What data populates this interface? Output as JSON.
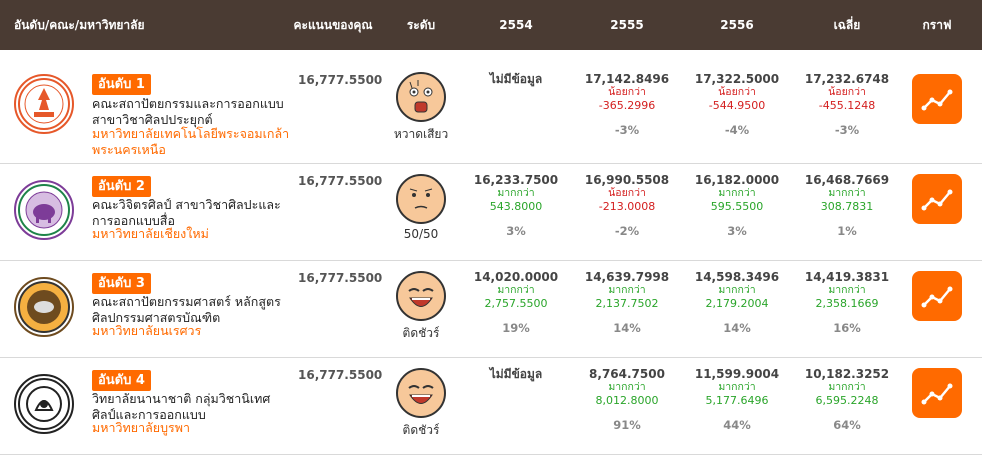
{
  "header": {
    "university": "อันดับ/คณะ/มหาวิทยาลัย",
    "score": "คะแนนของคุณ",
    "level": "ระดับ",
    "y2554": "2554",
    "y2555": "2555",
    "y2556": "2556",
    "avg": "เฉลี่ย",
    "graph": "กราฟ"
  },
  "rows": [
    {
      "rank": "อันดับ 1",
      "faculty": "คณะสถาปัตยกรรมและการออกแบบ สาขาวิชาศิลปประยุกต์",
      "university": "มหาวิทยาลัยเทคโนโลยีพระจอมเกล้าพระนครเหนือ",
      "score": "16,777.5500",
      "level": "หวาดเสียว",
      "face_icon": "scared-face-icon",
      "y2554": {
        "value": "ไม่มีข้อมูล"
      },
      "y2555": {
        "value": "17,142.8496",
        "cmp": "น้อยกว่า",
        "diff": "-365.2996",
        "pct": "-3%",
        "trend": "down"
      },
      "y2556": {
        "value": "17,322.5000",
        "cmp": "น้อยกว่า",
        "diff": "-544.9500",
        "pct": "-4%",
        "trend": "down"
      },
      "avg": {
        "value": "17,232.6748",
        "cmp": "น้อยกว่า",
        "diff": "-455.1248",
        "pct": "-3%",
        "trend": "down"
      }
    },
    {
      "rank": "อันดับ 2",
      "faculty": "คณะวิจิตรศิลป์ สาขาวิชาศิลปะและการออกแบบสื่อ",
      "university": "มหาวิทยาลัยเชียงใหม่",
      "score": "16,777.5500",
      "level": "50/50",
      "face_icon": "worried-face-icon",
      "y2554": {
        "value": "16,233.7500",
        "cmp": "มากกว่า",
        "diff": "543.8000",
        "pct": "3%",
        "trend": "up"
      },
      "y2555": {
        "value": "16,990.5508",
        "cmp": "น้อยกว่า",
        "diff": "-213.0008",
        "pct": "-2%",
        "trend": "down"
      },
      "y2556": {
        "value": "16,182.0000",
        "cmp": "มากกว่า",
        "diff": "595.5500",
        "pct": "3%",
        "trend": "up"
      },
      "avg": {
        "value": "16,468.7669",
        "cmp": "มากกว่า",
        "diff": "308.7831",
        "pct": "1%",
        "trend": "up"
      }
    },
    {
      "rank": "อันดับ 3",
      "faculty": "คณะสถาปัตยกรรมศาสตร์ หลักสูตรศิลปกรรมศาสตรบัณฑิต",
      "university": "มหาวิทยาลัยนเรศวร",
      "score": "16,777.5500",
      "level": "ติดชัวร์",
      "face_icon": "happy-face-icon",
      "y2554": {
        "value": "14,020.0000",
        "cmp": "มากกว่า",
        "diff": "2,757.5500",
        "pct": "19%",
        "trend": "up"
      },
      "y2555": {
        "value": "14,639.7998",
        "cmp": "มากกว่า",
        "diff": "2,137.7502",
        "pct": "14%",
        "trend": "up"
      },
      "y2556": {
        "value": "14,598.3496",
        "cmp": "มากกว่า",
        "diff": "2,179.2004",
        "pct": "14%",
        "trend": "up"
      },
      "avg": {
        "value": "14,419.3831",
        "cmp": "มากกว่า",
        "diff": "2,358.1669",
        "pct": "16%",
        "trend": "up"
      }
    },
    {
      "rank": "อันดับ 4",
      "faculty": "วิทยาลัยนานาชาติ กลุ่มวิชานิเทศศิลป์และการออกแบบ",
      "university": "มหาวิทยาลัยบูรพา",
      "score": "16,777.5500",
      "level": "ติดชัวร์",
      "face_icon": "happy-face-icon",
      "y2554": {
        "value": "ไม่มีข้อมูล"
      },
      "y2555": {
        "value": "8,764.7500",
        "cmp": "มากกว่า",
        "diff": "8,012.8000",
        "pct": "91%",
        "trend": "up"
      },
      "y2556": {
        "value": "11,599.9004",
        "cmp": "มากกว่า",
        "diff": "5,177.6496",
        "pct": "44%",
        "trend": "up"
      },
      "avg": {
        "value": "10,182.3252",
        "cmp": "มากกว่า",
        "diff": "6,595.2248",
        "pct": "64%",
        "trend": "up"
      }
    }
  ],
  "colors": {
    "header_bg": "#4a3b33",
    "accent": "#ff6a00",
    "up": "#2aa52a",
    "down": "#d42020"
  }
}
